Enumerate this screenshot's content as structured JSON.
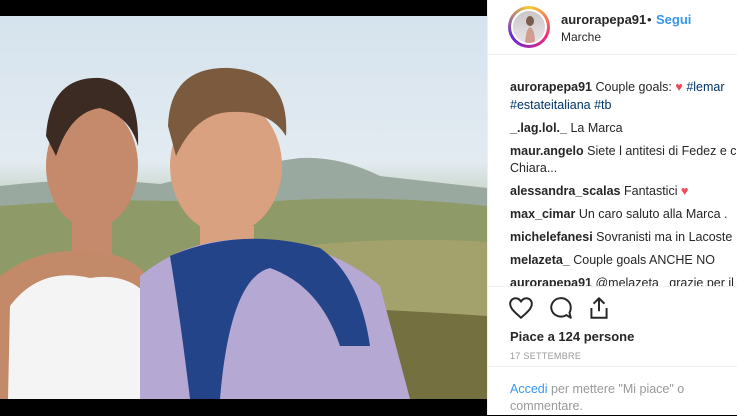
{
  "post": {
    "username": "aurorapepa91",
    "dot": "•",
    "follow_label": "Segui",
    "location": "Marche"
  },
  "comments": [
    {
      "user": "aurorapepa91",
      "text": "Couple goals:",
      "extra": "#lemar",
      "hashtags": "#estateitaliana #tb"
    },
    {
      "user": "_.lag.lol._",
      "text": "La Marca"
    },
    {
      "user": "maur.angelo",
      "text": "Siete l antitesi di Fedez e c",
      "cont": "Chiara..."
    },
    {
      "user": "alessandra_scalas",
      "text": "Fantastici"
    },
    {
      "user": "max_cimar",
      "text": "Un caro saluto alla Marca ."
    },
    {
      "user": "michelefanesi",
      "text": "Sovranisti ma in Lacoste"
    },
    {
      "user": "melazeta_",
      "text": "Couple goals ANCHE NO"
    },
    {
      "user": "aurorapepa91",
      "text": "@melazeta_ grazie per il"
    }
  ],
  "actions": {
    "likes": "Piace a 124 persone",
    "date": "17 SETTEMBRE"
  },
  "footer": {
    "login": "Accedi",
    "rest": "per mettere \"Mi piace\" o commentare."
  },
  "icons": [
    "heart-icon",
    "comment-icon",
    "share-icon"
  ],
  "colors": {
    "link": "#3897f0",
    "heart": "#ed4956",
    "hashtag": "#003569"
  }
}
